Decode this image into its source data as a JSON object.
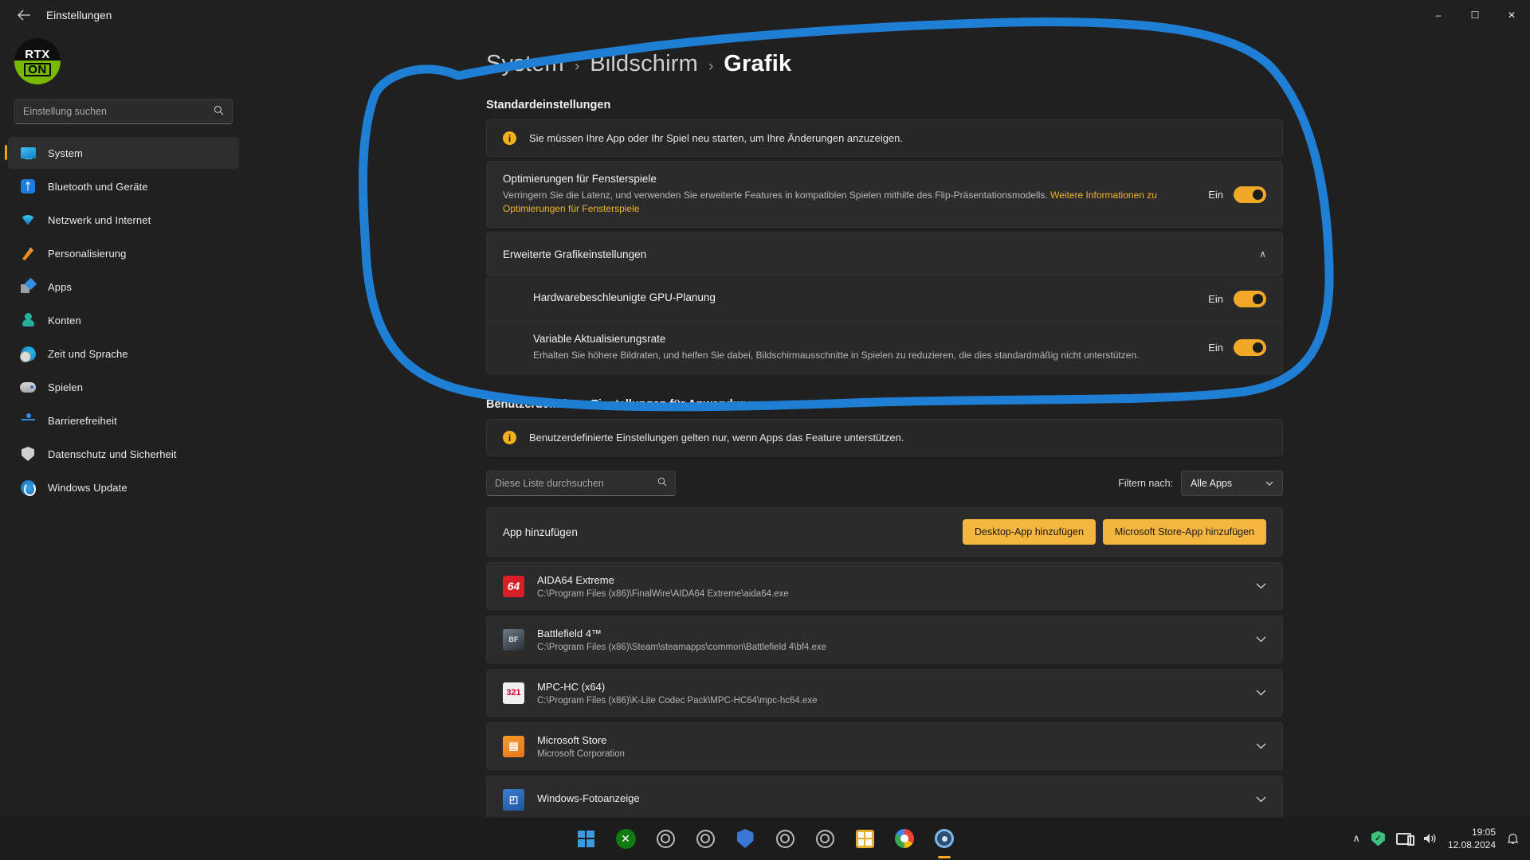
{
  "window": {
    "title": "Einstellungen",
    "back_icon": "back-arrow-icon",
    "minimize": "–",
    "maximize": "☐",
    "close": "✕"
  },
  "profile": {
    "avatar_top": "RTX",
    "avatar_bottom": "ON",
    "name": "",
    "email": ""
  },
  "search": {
    "placeholder": "Einstellung suchen",
    "icon": "search-icon"
  },
  "sidebar": {
    "items": [
      {
        "label": "System",
        "icon": "monitor-icon",
        "selected": true
      },
      {
        "label": "Bluetooth und Geräte",
        "icon": "bluetooth-icon",
        "selected": false
      },
      {
        "label": "Netzwerk und Internet",
        "icon": "wifi-icon",
        "selected": false
      },
      {
        "label": "Personalisierung",
        "icon": "paintbrush-icon",
        "selected": false
      },
      {
        "label": "Apps",
        "icon": "apps-icon",
        "selected": false
      },
      {
        "label": "Konten",
        "icon": "user-icon",
        "selected": false
      },
      {
        "label": "Zeit und Sprache",
        "icon": "clock-globe-icon",
        "selected": false
      },
      {
        "label": "Spielen",
        "icon": "gamepad-icon",
        "selected": false
      },
      {
        "label": "Barrierefreiheit",
        "icon": "accessibility-icon",
        "selected": false
      },
      {
        "label": "Datenschutz und Sicherheit",
        "icon": "shield-icon",
        "selected": false
      },
      {
        "label": "Windows Update",
        "icon": "update-icon",
        "selected": false
      }
    ]
  },
  "breadcrumb": {
    "level1": "System",
    "level2": "Bildschirm",
    "level3": "Grafik",
    "separator": "›"
  },
  "main": {
    "section_default_title": "Standardeinstellungen",
    "restart_banner": "Sie müssen Ihre App oder Ihr Spiel neu starten, um Ihre Änderungen anzuzeigen.",
    "windowed_games": {
      "title": "Optimierungen für Fensterspiele",
      "desc_part1": "Verringern Sie die Latenz, und verwenden Sie erweiterte Features in kompatiblen Spielen mithilfe des Flip-Präsentationsmodells.",
      "link": "Weitere Informationen zu Optimierungen für Fensterspiele",
      "state": "Ein"
    },
    "advanced": {
      "title": "Erweiterte Grafikeinstellungen",
      "chevron": "∧",
      "rows": [
        {
          "title": "Hardwarebeschleunigte GPU-Planung",
          "desc": "",
          "state": "Ein"
        },
        {
          "title": "Variable Aktualisierungsrate",
          "desc": "Erhalten Sie höhere Bildraten, und helfen Sie dabei, Bildschirmausschnitte in Spielen zu reduzieren, die dies standardmäßig nicht unterstützen.",
          "state": "Ein"
        }
      ]
    },
    "section_custom_title": "Benutzerdefinierte Einstellungen für Anwendungen",
    "custom_banner": "Benutzerdefinierte Einstellungen gelten nur, wenn Apps das Feature unterstützen.",
    "list_search_placeholder": "Diese Liste durchsuchen",
    "filter_label": "Filtern nach:",
    "filter_value": "Alle Apps",
    "add_app": {
      "title": "App hinzufügen",
      "desktop_button": "Desktop-App hinzufügen",
      "store_button": "Microsoft Store-App hinzufügen"
    },
    "apps": [
      {
        "name": "AIDA64 Extreme",
        "path": "C:\\Program Files (x86)\\FinalWire\\AIDA64 Extreme\\aida64.exe",
        "icon_class": "ai-aida",
        "icon_text": "64"
      },
      {
        "name": "Battlefield 4™",
        "path": "C:\\Program Files (x86)\\Steam\\steamapps\\common\\Battlefield 4\\bf4.exe",
        "icon_class": "ai-bf4",
        "icon_text": "BF"
      },
      {
        "name": "MPC-HC (x64)",
        "path": "C:\\Program Files (x86)\\K-Lite Codec Pack\\MPC-HC64\\mpc-hc64.exe",
        "icon_class": "ai-mpc",
        "icon_text": "321"
      },
      {
        "name": "Microsoft Store",
        "path": "Microsoft Corporation",
        "icon_class": "ai-store",
        "icon_text": "▤"
      },
      {
        "name": "Windows-Fotoanzeige",
        "path": "",
        "icon_class": "ai-photo",
        "icon_text": "◰"
      }
    ]
  },
  "annotation": {
    "color": "#1f7fd4",
    "shape": "hand-drawn-ellipse"
  },
  "taskbar": {
    "items": [
      {
        "name": "start-button",
        "icon": "windows-logo-icon"
      },
      {
        "name": "xbox-app",
        "icon": "xbox-icon"
      },
      {
        "name": "app-3",
        "icon": "circle-icon"
      },
      {
        "name": "app-4",
        "icon": "circle-icon"
      },
      {
        "name": "windows-security",
        "icon": "defender-shield-icon"
      },
      {
        "name": "app-6",
        "icon": "circle-icon"
      },
      {
        "name": "app-7",
        "icon": "circle-icon"
      },
      {
        "name": "microsoft-store",
        "icon": "store-icon"
      },
      {
        "name": "google-chrome",
        "icon": "chrome-icon"
      },
      {
        "name": "settings",
        "icon": "gear-icon"
      }
    ],
    "tray": {
      "chevron": "∧",
      "shield": "✓",
      "network_icon": "network-icon",
      "volume_icon": "🔊",
      "time": "19:05",
      "date": "12.08.2024",
      "bell": "🔔"
    }
  }
}
